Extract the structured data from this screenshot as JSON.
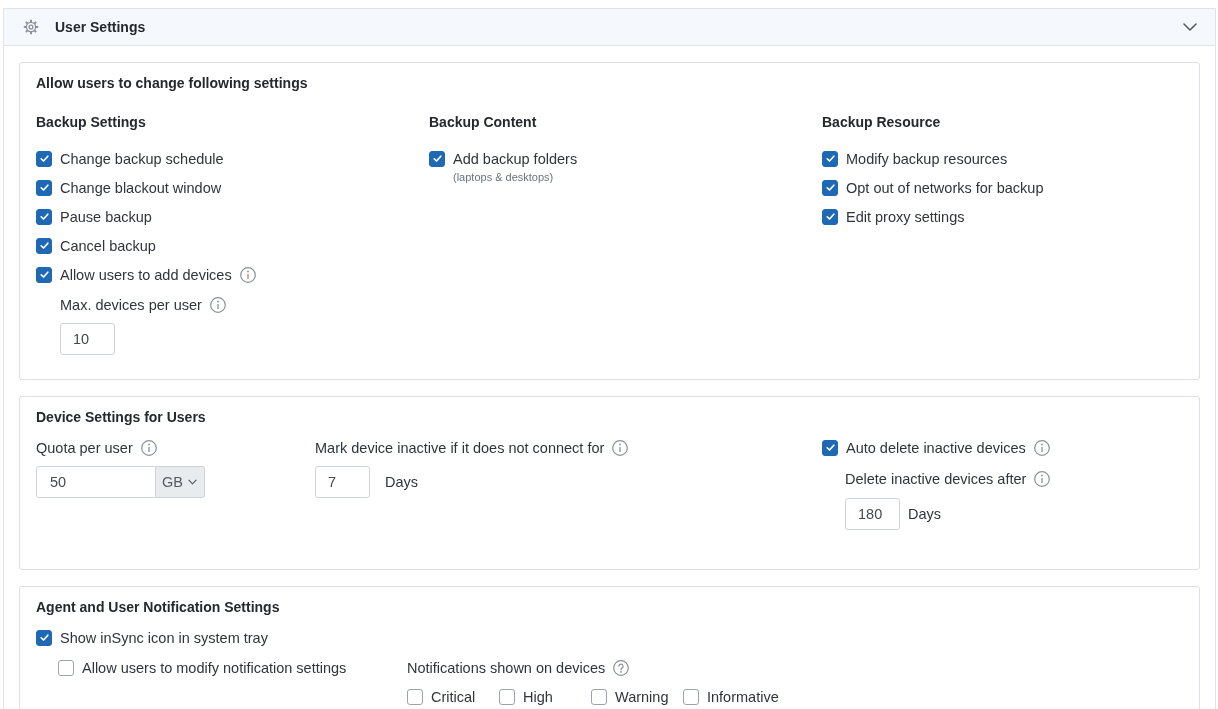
{
  "panel": {
    "title": "User Settings",
    "expanded": true
  },
  "user_permissions": {
    "title": "Allow users to change following settings",
    "columns": [
      {
        "heading": "Backup Settings",
        "options": [
          {
            "label": "Change backup schedule",
            "checked": true
          },
          {
            "label": "Change blackout window",
            "checked": true
          },
          {
            "label": "Pause backup",
            "checked": true
          },
          {
            "label": "Cancel backup",
            "checked": true
          },
          {
            "label": "Allow users to add devices",
            "checked": true,
            "info_icon": true,
            "sub_field": {
              "label": "Max. devices per user",
              "info_icon": true,
              "value": "10"
            }
          }
        ]
      },
      {
        "heading": "Backup Content",
        "options": [
          {
            "label": "Add backup folders",
            "note": "(laptops & desktops)",
            "checked": true
          }
        ]
      },
      {
        "heading": "Backup Resource",
        "options": [
          {
            "label": "Modify backup resources",
            "checked": true
          },
          {
            "label": "Opt out of networks for backup",
            "checked": true
          },
          {
            "label": "Edit proxy settings",
            "checked": true
          }
        ]
      }
    ]
  },
  "device_settings": {
    "title": "Device Settings for Users",
    "quota": {
      "label": "Quota per user",
      "info_icon": true,
      "value": "50",
      "unit": "GB"
    },
    "inactivity": {
      "label": "Mark device inactive if it does not connect for",
      "info_icon": true,
      "value": "7",
      "unit": "Days"
    },
    "auto_delete": {
      "label": "Auto delete inactive devices",
      "checked": true,
      "info_icon": true,
      "sub_field": {
        "label": "Delete inactive devices after",
        "info_icon": true,
        "value": "180",
        "unit": "Days"
      }
    }
  },
  "notification_settings": {
    "title": "Agent and User Notification Settings",
    "tray_icon": {
      "label": "Show inSync icon in system tray",
      "checked": true
    },
    "user_modify": {
      "label": "Allow users to modify notification settings",
      "checked": false
    },
    "shown_on_devices": {
      "label": "Notifications shown on devices",
      "help_icon": true,
      "options": [
        {
          "label": "Critical",
          "checked": false
        },
        {
          "label": "High",
          "checked": false
        },
        {
          "label": "Warning",
          "checked": false
        },
        {
          "label": "Informative",
          "checked": false
        }
      ]
    }
  }
}
